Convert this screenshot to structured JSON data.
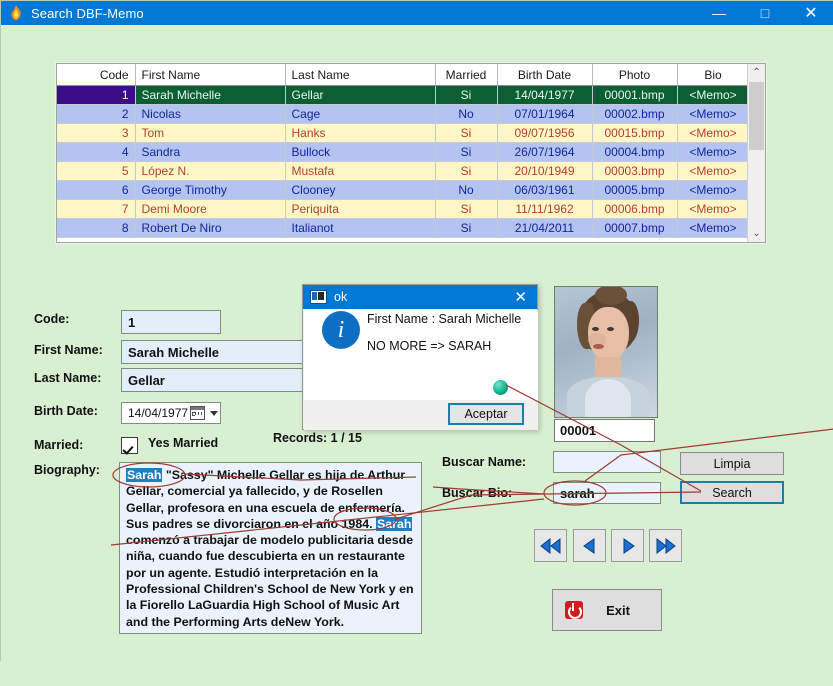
{
  "window": {
    "title": "Search DBF-Memo",
    "icon": "flame-icon",
    "minimize": "—",
    "maximize": "□",
    "close": "✕"
  },
  "grid": {
    "columns": [
      "Code",
      "First Name",
      "Last Name",
      "Married",
      "Birth Date",
      "Photo",
      "Bio"
    ],
    "rows": [
      {
        "code": "1",
        "first": "Sarah Michelle",
        "last": "Gellar",
        "married": "Si",
        "birth": "14/04/1977",
        "photo": "00001.bmp",
        "bio": "<Memo>",
        "style": "sel"
      },
      {
        "code": "2",
        "first": "Nicolas",
        "last": "Cage",
        "married": "No",
        "birth": "07/01/1964",
        "photo": "00002.bmp",
        "bio": "<Memo>",
        "style": "a"
      },
      {
        "code": "3",
        "first": "Tom",
        "last": "Hanks",
        "married": "Si",
        "birth": "09/07/1956",
        "photo": "00015.bmp",
        "bio": "<Memo>",
        "style": "b"
      },
      {
        "code": "4",
        "first": "Sandra",
        "last": "Bullock",
        "married": "Si",
        "birth": "26/07/1964",
        "photo": "00004.bmp",
        "bio": "<Memo>",
        "style": "a"
      },
      {
        "code": "5",
        "first": "López N.",
        "last": "Mustafa",
        "married": "Si",
        "birth": "20/10/1949",
        "photo": "00003.bmp",
        "bio": "<Memo>",
        "style": "b"
      },
      {
        "code": "6",
        "first": "George Timothy",
        "last": "Clooney",
        "married": "No",
        "birth": "06/03/1961",
        "photo": "00005.bmp",
        "bio": "<Memo>",
        "style": "a"
      },
      {
        "code": "7",
        "first": "Demi Moore",
        "last": "Periquita",
        "married": "Si",
        "birth": "11/11/1962",
        "photo": "00006.bmp",
        "bio": "<Memo>",
        "style": "b"
      },
      {
        "code": "8",
        "first": "Robert De Niro",
        "last": "Italianot",
        "married": "Si",
        "birth": "21/04/2011",
        "photo": "00007.bmp",
        "bio": "<Memo>",
        "style": "a"
      }
    ],
    "scroll_up": "⌃",
    "scroll_down": "⌄"
  },
  "form": {
    "code_label": "Code:",
    "code_value": "1",
    "first_label": "First Name:",
    "first_value": "Sarah Michelle",
    "last_label": "Last Name:",
    "last_value": "Gellar",
    "birth_label": "Birth Date:",
    "birth_value": "14/04/1977",
    "married_label": "Married:",
    "married_checkbox_text": "Yes Married",
    "biography_label": "Biography:",
    "records_status": "Records:  1 / 15",
    "photo_name": "00001",
    "bio_part1": "Sarah",
    "bio_part2": " \"Sassy\" Michelle Gellar es hija de Arthur Gellar, comercial ya fallecido, y de Rosellen Gellar, profesora en una escuela de enfermería. Sus padres se divorciaron en el año 1984. ",
    "bio_part3": "Sarah",
    "bio_part4": " comenzó a trabajar de modelo publicitaria desde niña, cuando fue descubierta en un restaurante por un agente. Estudió interpretación en la Professional Children's School de New York y en la Fiorello LaGuardia High School of Music Art and the Performing Arts deNew York."
  },
  "search": {
    "buscar_name_label": "Buscar Name:",
    "buscar_name_value": "",
    "buscar_bio_label": "Buscar Bio:",
    "buscar_bio_value": "sarah",
    "limpia_button": "Limpia",
    "search_button": "Search"
  },
  "nav": {
    "first": "⏮",
    "prev": "◀",
    "next": "▶",
    "last": "⏭",
    "exit_label": "Exit",
    "exit_icon": "power-icon"
  },
  "dialog": {
    "title": "ok",
    "close": "✕",
    "icon": "info-icon",
    "message_line1": "First Name  : Sarah Michelle",
    "message_line2": "NO MORE  =>  SARAH",
    "ok_button": "Aceptar"
  },
  "colors": {
    "background": "#d9efd1",
    "titlebar": "#0078d4",
    "row_blue": "#b4c3f0",
    "row_yellow": "#fdf7c8",
    "selected_row": "#0b5f33",
    "selected_code": "#3b0e87",
    "highlight": "#1f7fc4",
    "annotation": "#9e3b33",
    "focus_border": "#1a7fa8"
  }
}
